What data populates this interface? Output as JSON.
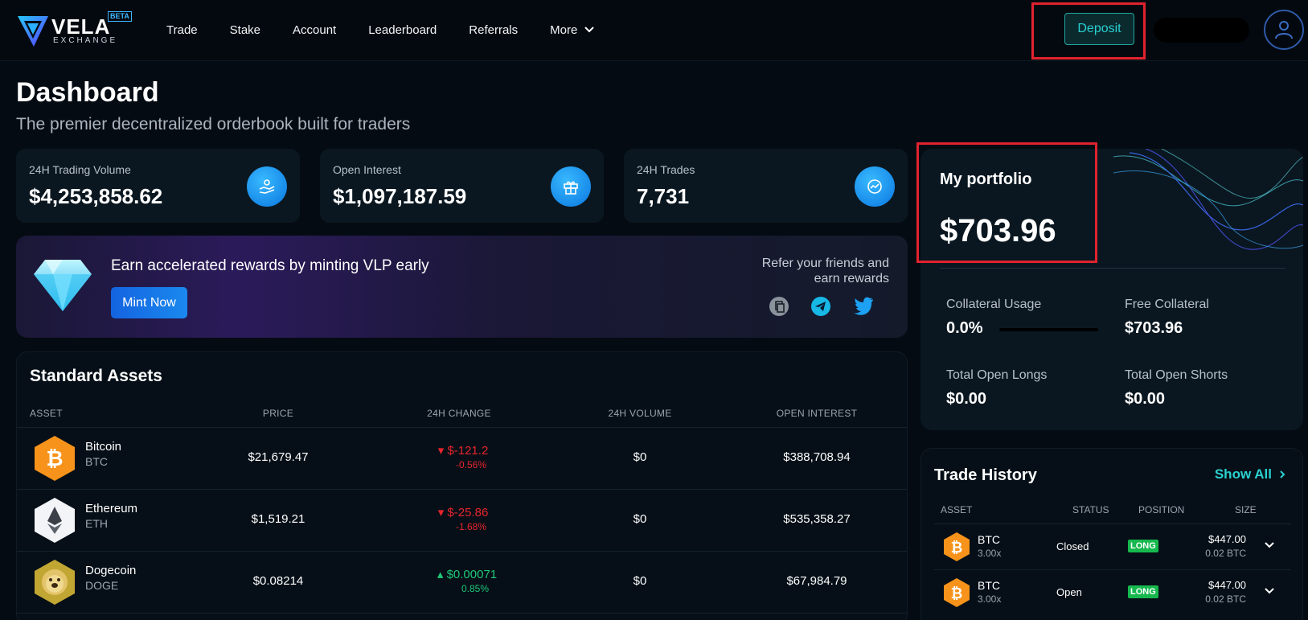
{
  "brand": {
    "name": "VELA",
    "sub": "EXCHANGE",
    "badge": "BETA"
  },
  "nav": [
    {
      "label": "Trade"
    },
    {
      "label": "Stake"
    },
    {
      "label": "Account"
    },
    {
      "label": "Leaderboard"
    },
    {
      "label": "Referrals"
    },
    {
      "label": "More"
    }
  ],
  "header": {
    "deposit_label": "Deposit",
    "title": "Dashboard",
    "subtitle": "The premier decentralized orderbook built for traders"
  },
  "stats": [
    {
      "label": "24H Trading Volume",
      "value": "$4,253,858.62",
      "icon": "hand-coins-icon"
    },
    {
      "label": "Open Interest",
      "value": "$1,097,187.59",
      "icon": "gift-icon"
    },
    {
      "label": "24H Trades",
      "value": "7,731",
      "icon": "trend-icon"
    }
  ],
  "banner": {
    "text": "Earn accelerated rewards by minting VLP early",
    "button": "Mint Now",
    "refer": "Refer your friends and earn rewards"
  },
  "assets": {
    "title": "Standard Assets",
    "columns": [
      "ASSET",
      "PRICE",
      "24H CHANGE",
      "24H VOLUME",
      "OPEN INTEREST"
    ],
    "rows": [
      {
        "name": "Bitcoin",
        "symbol": "BTC",
        "price": "$21,679.47",
        "change": "$-121.2",
        "change_pct": "-0.56%",
        "direction": "down",
        "volume": "$0",
        "open_interest": "$388,708.94"
      },
      {
        "name": "Ethereum",
        "symbol": "ETH",
        "price": "$1,519.21",
        "change": "$-25.86",
        "change_pct": "-1.68%",
        "direction": "down",
        "volume": "$0",
        "open_interest": "$535,358.27"
      },
      {
        "name": "Dogecoin",
        "symbol": "DOGE",
        "price": "$0.08214",
        "change": "$0.00071",
        "change_pct": "0.85%",
        "direction": "up",
        "volume": "$0",
        "open_interest": "$67,984.79"
      }
    ]
  },
  "portfolio": {
    "title": "My portfolio",
    "value": "$703.96",
    "collateral_usage_label": "Collateral Usage",
    "collateral_usage": "0.0%",
    "free_collateral_label": "Free Collateral",
    "free_collateral": "$703.96",
    "longs_label": "Total Open Longs",
    "longs": "$0.00",
    "shorts_label": "Total Open Shorts",
    "shorts": "$0.00"
  },
  "history": {
    "title": "Trade History",
    "show_all": "Show All",
    "columns": [
      "ASSET",
      "STATUS",
      "POSITION",
      "SIZE"
    ],
    "rows": [
      {
        "asset": "BTC",
        "leverage": "3.00x",
        "status": "Closed",
        "position": "LONG",
        "size": "$447.00",
        "size_btc": "0.02 BTC"
      },
      {
        "asset": "BTC",
        "leverage": "3.00x",
        "status": "Open",
        "position": "LONG",
        "size": "$447.00",
        "size_btc": "0.02 BTC"
      }
    ]
  },
  "colors": {
    "accent": "#2ad0d0",
    "highlight": "#e0232f",
    "up": "#1fc878",
    "down": "#e8242d",
    "long": "#16b84e"
  }
}
